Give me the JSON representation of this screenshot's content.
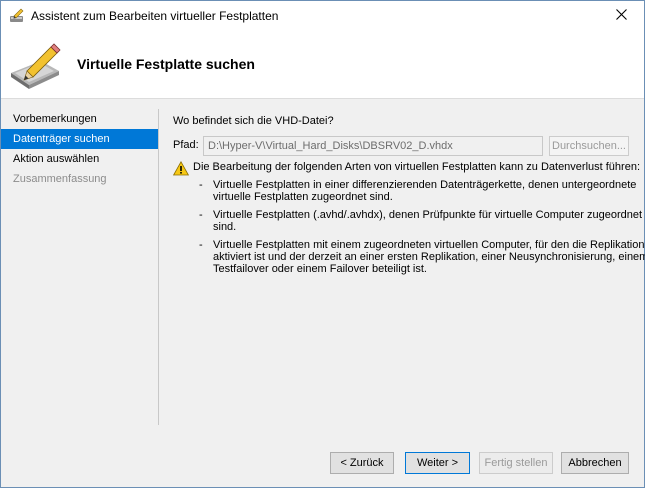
{
  "window": {
    "title": "Assistent zum Bearbeiten virtueller Festplatten",
    "close_icon": "close-icon"
  },
  "header": {
    "title": "Virtuelle Festplatte suchen",
    "icon": "disk-pencil-icon"
  },
  "nav": {
    "items": [
      {
        "label": "Vorbemerkungen",
        "state": "normal"
      },
      {
        "label": "Datenträger suchen",
        "state": "selected"
      },
      {
        "label": "Aktion auswählen",
        "state": "normal"
      },
      {
        "label": "Zusammenfassung",
        "state": "disabled"
      }
    ]
  },
  "content": {
    "question": "Wo befindet sich die VHD-Datei?",
    "path_label": "Pfad:",
    "path_value": "D:\\Hyper-V\\Virtual_Hard_Disks\\DBSRV02_D.vhdx",
    "browse_label": "Durchsuchen...",
    "warning_icon": "warning-icon",
    "warning_text": "Die Bearbeitung der folgenden Arten von virtuellen Festplatten kann zu Datenverlust führen:",
    "bullets": [
      [
        "Virtuelle Festplatten in einer differenzierenden Datenträgerkette, denen untergeordnete",
        "virtuelle Festplatten zugeordnet sind."
      ],
      [
        "Virtuelle Festplatten (.avhd/.avhdx), denen Prüfpunkte für virtuelle Computer zugeordnet",
        "sind."
      ],
      [
        "Virtuelle Festplatten mit einem zugeordneten virtuellen Computer, für den die Replikation",
        "aktiviert ist und der derzeit an einer ersten Replikation, einer Neusynchronisierung, einem",
        "Testfailover oder einem Failover beteiligt ist."
      ]
    ]
  },
  "buttons": {
    "back": "< Zurück",
    "next": "Weiter >",
    "finish": "Fertig stellen",
    "cancel": "Abbrechen"
  },
  "colors": {
    "selection": "#0078d7",
    "window_border": "#6b8fb5",
    "background": "#f0f0f0"
  }
}
